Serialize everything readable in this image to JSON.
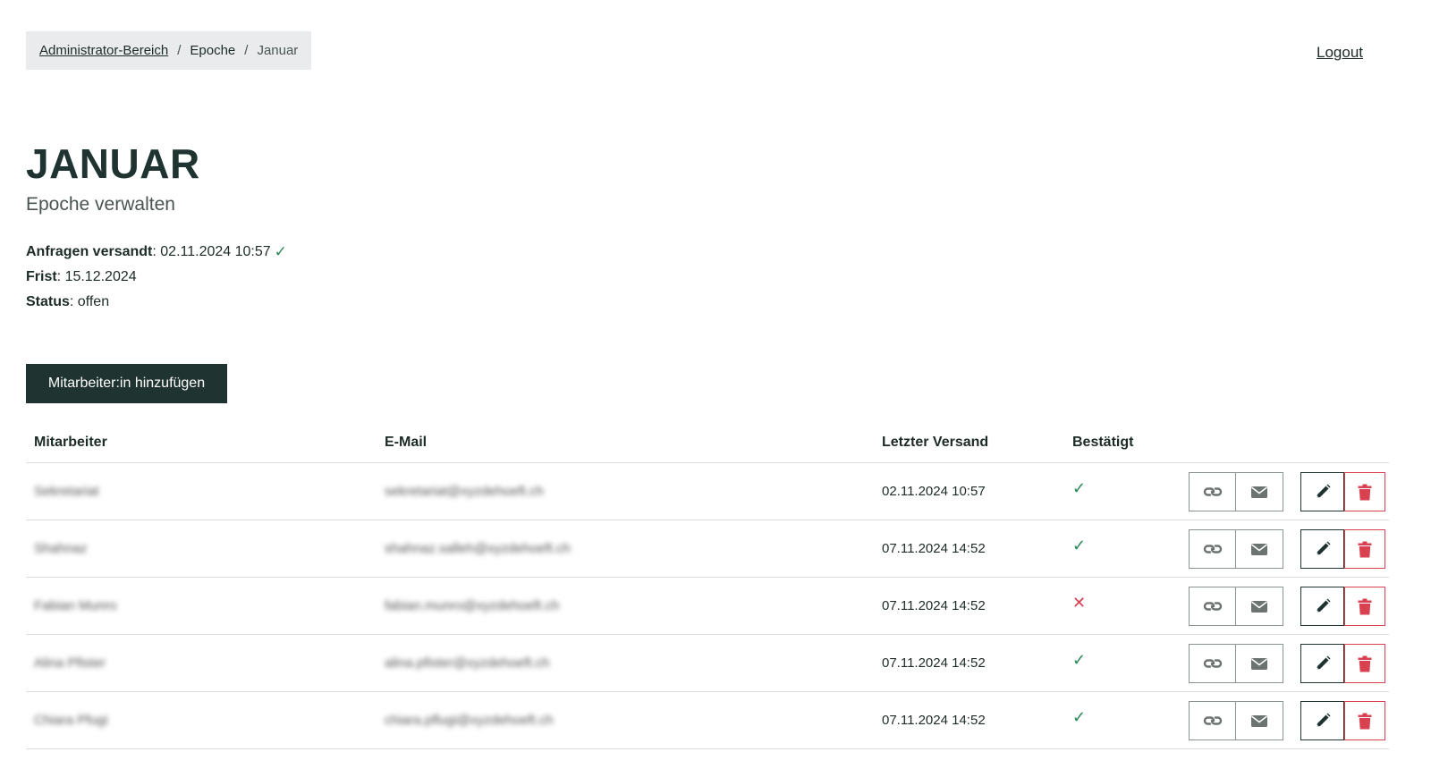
{
  "breadcrumb": {
    "items": [
      "Administrator-Bereich",
      "Epoche",
      "Januar"
    ],
    "separator": "/"
  },
  "header": {
    "logout_label": "Logout"
  },
  "page": {
    "title": "JANUAR",
    "subtitle": "Epoche verwalten"
  },
  "meta": {
    "sent_label": "Anfragen versandt",
    "sent_value": "02.11.2024 10:57",
    "deadline_label": "Frist",
    "deadline_value": "15.12.2024",
    "status_label": "Status",
    "status_value": "offen"
  },
  "add_button_label": "Mitarbeiter:in hinzufügen",
  "table": {
    "columns": [
      "Mitarbeiter",
      "E-Mail",
      "Letzter Versand",
      "Bestätigt"
    ],
    "rows": [
      {
        "name": "Sekretariat",
        "email": "sekretariat@xyzdehoeft.ch",
        "last_sent": "02.11.2024 10:57",
        "confirmed": true
      },
      {
        "name": "Shahnaz",
        "email": "shahnaz.salleh@xyzdehoeft.ch",
        "last_sent": "07.11.2024 14:52",
        "confirmed": true
      },
      {
        "name": "Fabian Munro",
        "email": "fabian.munro@xyzdehoeft.ch",
        "last_sent": "07.11.2024 14:52",
        "confirmed": false
      },
      {
        "name": "Alina Pfister",
        "email": "alina.pfister@xyzdehoeft.ch",
        "last_sent": "07.11.2024 14:52",
        "confirmed": true
      },
      {
        "name": "Chiara Pfugi",
        "email": "chiara.pflugi@xyzdehoeft.ch",
        "last_sent": "07.11.2024 14:52",
        "confirmed": true
      }
    ]
  },
  "icons": {
    "confirmed": "check-icon",
    "not_confirmed": "cross-icon",
    "actions": [
      "link-icon",
      "envelope-icon",
      "pencil-icon",
      "trash-icon"
    ]
  },
  "colors": {
    "primary": "#1f3330",
    "success": "#2e8a5b",
    "danger": "#d94150",
    "breadcrumb_bg": "#e9ebec"
  }
}
